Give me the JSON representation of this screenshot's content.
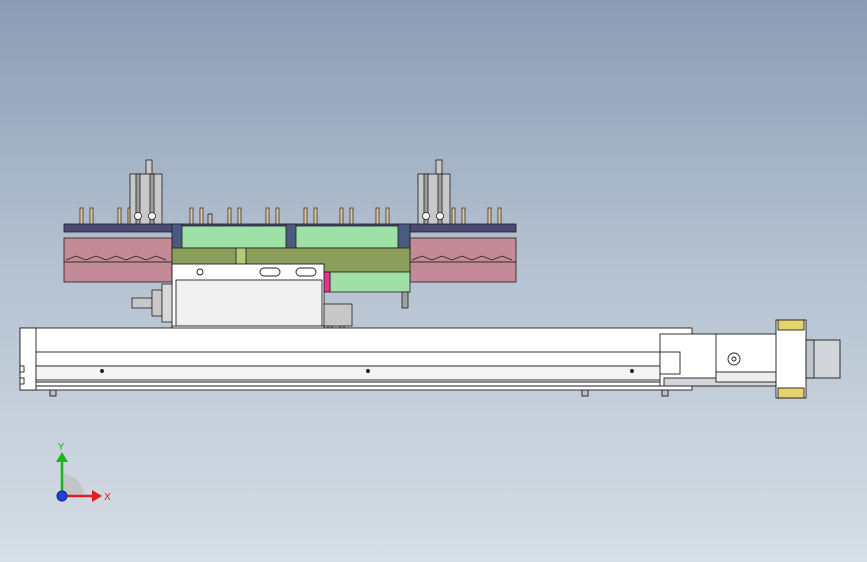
{
  "viewport": {
    "background_top": "#8b9db5",
    "background_bottom": "#d6dee6"
  },
  "model": {
    "colors": {
      "frame": "#ffffff",
      "edge": "#1e1e1e",
      "plate_dark": "#4a4a74",
      "pink_block": "#c48a98",
      "green_light": "#9fe0a6",
      "green_olive": "#8aa05a",
      "cyan_part": "#78e6e6",
      "magenta_part": "#e8338c",
      "motor_yellow": "#e6d36e",
      "rail_gray": "#d2d6da"
    }
  },
  "triad": {
    "x_label": "X",
    "y_label": "Y",
    "x_color": "#e02020",
    "y_color": "#20b020",
    "z_color": "#2040e0"
  }
}
